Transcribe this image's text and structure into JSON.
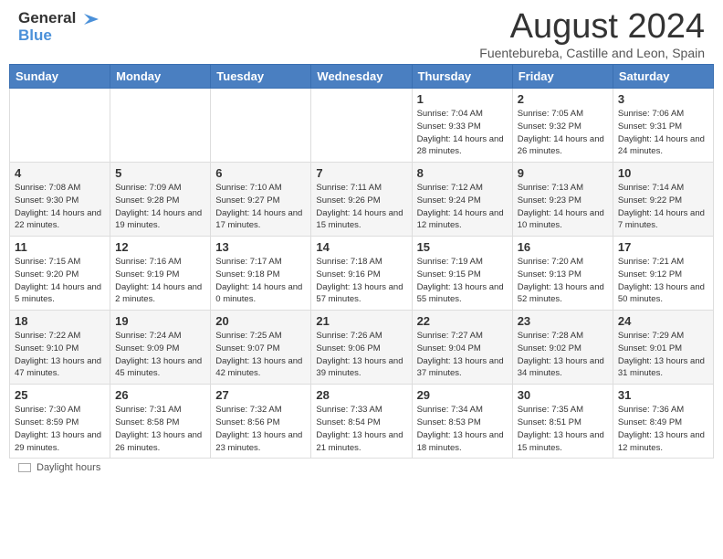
{
  "header": {
    "logo_line1": "General",
    "logo_line2": "Blue",
    "month_year": "August 2024",
    "location": "Fuentebureba, Castille and Leon, Spain"
  },
  "days_of_week": [
    "Sunday",
    "Monday",
    "Tuesday",
    "Wednesday",
    "Thursday",
    "Friday",
    "Saturday"
  ],
  "weeks": [
    [
      {
        "day": "",
        "sunrise": "",
        "sunset": "",
        "daylight": ""
      },
      {
        "day": "",
        "sunrise": "",
        "sunset": "",
        "daylight": ""
      },
      {
        "day": "",
        "sunrise": "",
        "sunset": "",
        "daylight": ""
      },
      {
        "day": "",
        "sunrise": "",
        "sunset": "",
        "daylight": ""
      },
      {
        "day": "1",
        "sunrise": "Sunrise: 7:04 AM",
        "sunset": "Sunset: 9:33 PM",
        "daylight": "Daylight: 14 hours and 28 minutes."
      },
      {
        "day": "2",
        "sunrise": "Sunrise: 7:05 AM",
        "sunset": "Sunset: 9:32 PM",
        "daylight": "Daylight: 14 hours and 26 minutes."
      },
      {
        "day": "3",
        "sunrise": "Sunrise: 7:06 AM",
        "sunset": "Sunset: 9:31 PM",
        "daylight": "Daylight: 14 hours and 24 minutes."
      }
    ],
    [
      {
        "day": "4",
        "sunrise": "Sunrise: 7:08 AM",
        "sunset": "Sunset: 9:30 PM",
        "daylight": "Daylight: 14 hours and 22 minutes."
      },
      {
        "day": "5",
        "sunrise": "Sunrise: 7:09 AM",
        "sunset": "Sunset: 9:28 PM",
        "daylight": "Daylight: 14 hours and 19 minutes."
      },
      {
        "day": "6",
        "sunrise": "Sunrise: 7:10 AM",
        "sunset": "Sunset: 9:27 PM",
        "daylight": "Daylight: 14 hours and 17 minutes."
      },
      {
        "day": "7",
        "sunrise": "Sunrise: 7:11 AM",
        "sunset": "Sunset: 9:26 PM",
        "daylight": "Daylight: 14 hours and 15 minutes."
      },
      {
        "day": "8",
        "sunrise": "Sunrise: 7:12 AM",
        "sunset": "Sunset: 9:24 PM",
        "daylight": "Daylight: 14 hours and 12 minutes."
      },
      {
        "day": "9",
        "sunrise": "Sunrise: 7:13 AM",
        "sunset": "Sunset: 9:23 PM",
        "daylight": "Daylight: 14 hours and 10 minutes."
      },
      {
        "day": "10",
        "sunrise": "Sunrise: 7:14 AM",
        "sunset": "Sunset: 9:22 PM",
        "daylight": "Daylight: 14 hours and 7 minutes."
      }
    ],
    [
      {
        "day": "11",
        "sunrise": "Sunrise: 7:15 AM",
        "sunset": "Sunset: 9:20 PM",
        "daylight": "Daylight: 14 hours and 5 minutes."
      },
      {
        "day": "12",
        "sunrise": "Sunrise: 7:16 AM",
        "sunset": "Sunset: 9:19 PM",
        "daylight": "Daylight: 14 hours and 2 minutes."
      },
      {
        "day": "13",
        "sunrise": "Sunrise: 7:17 AM",
        "sunset": "Sunset: 9:18 PM",
        "daylight": "Daylight: 14 hours and 0 minutes."
      },
      {
        "day": "14",
        "sunrise": "Sunrise: 7:18 AM",
        "sunset": "Sunset: 9:16 PM",
        "daylight": "Daylight: 13 hours and 57 minutes."
      },
      {
        "day": "15",
        "sunrise": "Sunrise: 7:19 AM",
        "sunset": "Sunset: 9:15 PM",
        "daylight": "Daylight: 13 hours and 55 minutes."
      },
      {
        "day": "16",
        "sunrise": "Sunrise: 7:20 AM",
        "sunset": "Sunset: 9:13 PM",
        "daylight": "Daylight: 13 hours and 52 minutes."
      },
      {
        "day": "17",
        "sunrise": "Sunrise: 7:21 AM",
        "sunset": "Sunset: 9:12 PM",
        "daylight": "Daylight: 13 hours and 50 minutes."
      }
    ],
    [
      {
        "day": "18",
        "sunrise": "Sunrise: 7:22 AM",
        "sunset": "Sunset: 9:10 PM",
        "daylight": "Daylight: 13 hours and 47 minutes."
      },
      {
        "day": "19",
        "sunrise": "Sunrise: 7:24 AM",
        "sunset": "Sunset: 9:09 PM",
        "daylight": "Daylight: 13 hours and 45 minutes."
      },
      {
        "day": "20",
        "sunrise": "Sunrise: 7:25 AM",
        "sunset": "Sunset: 9:07 PM",
        "daylight": "Daylight: 13 hours and 42 minutes."
      },
      {
        "day": "21",
        "sunrise": "Sunrise: 7:26 AM",
        "sunset": "Sunset: 9:06 PM",
        "daylight": "Daylight: 13 hours and 39 minutes."
      },
      {
        "day": "22",
        "sunrise": "Sunrise: 7:27 AM",
        "sunset": "Sunset: 9:04 PM",
        "daylight": "Daylight: 13 hours and 37 minutes."
      },
      {
        "day": "23",
        "sunrise": "Sunrise: 7:28 AM",
        "sunset": "Sunset: 9:02 PM",
        "daylight": "Daylight: 13 hours and 34 minutes."
      },
      {
        "day": "24",
        "sunrise": "Sunrise: 7:29 AM",
        "sunset": "Sunset: 9:01 PM",
        "daylight": "Daylight: 13 hours and 31 minutes."
      }
    ],
    [
      {
        "day": "25",
        "sunrise": "Sunrise: 7:30 AM",
        "sunset": "Sunset: 8:59 PM",
        "daylight": "Daylight: 13 hours and 29 minutes."
      },
      {
        "day": "26",
        "sunrise": "Sunrise: 7:31 AM",
        "sunset": "Sunset: 8:58 PM",
        "daylight": "Daylight: 13 hours and 26 minutes."
      },
      {
        "day": "27",
        "sunrise": "Sunrise: 7:32 AM",
        "sunset": "Sunset: 8:56 PM",
        "daylight": "Daylight: 13 hours and 23 minutes."
      },
      {
        "day": "28",
        "sunrise": "Sunrise: 7:33 AM",
        "sunset": "Sunset: 8:54 PM",
        "daylight": "Daylight: 13 hours and 21 minutes."
      },
      {
        "day": "29",
        "sunrise": "Sunrise: 7:34 AM",
        "sunset": "Sunset: 8:53 PM",
        "daylight": "Daylight: 13 hours and 18 minutes."
      },
      {
        "day": "30",
        "sunrise": "Sunrise: 7:35 AM",
        "sunset": "Sunset: 8:51 PM",
        "daylight": "Daylight: 13 hours and 15 minutes."
      },
      {
        "day": "31",
        "sunrise": "Sunrise: 7:36 AM",
        "sunset": "Sunset: 8:49 PM",
        "daylight": "Daylight: 13 hours and 12 minutes."
      }
    ]
  ],
  "footer": {
    "daylight_label": "Daylight hours"
  },
  "colors": {
    "header_bg": "#4a7fc1",
    "accent": "#4a90d9"
  }
}
